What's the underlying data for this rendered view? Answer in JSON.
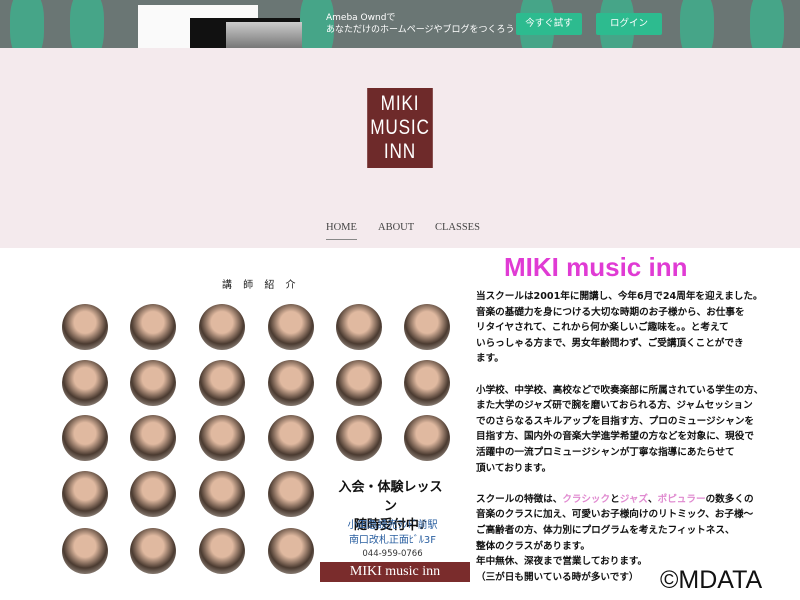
{
  "banner": {
    "line1": "Ameba Owndで",
    "line2": "あなただけのホームページやブログをつくろう",
    "try_button": "今すぐ試す",
    "login_button": "ログイン"
  },
  "logo": {
    "text": "MIKI MUSIC INN"
  },
  "nav": [
    {
      "label": "HOME"
    },
    {
      "label": "ABOUT"
    },
    {
      "label": "CLASSES"
    }
  ],
  "instructors": {
    "title": "講 師 紹 介"
  },
  "promo": {
    "line1": "入会・体験レッスン",
    "line2": "随時受付中♪",
    "addr1": "小田急読売ﾗﾝﾄﾞ前駅",
    "addr2": "南口改札正面ﾋﾞﾙ3F",
    "phone": "044-959-0766",
    "banner": "MIKI music inn"
  },
  "main": {
    "title": "MIKI music inn",
    "p1": [
      "当スクールは2001年に開講し、今年6月で24周年を迎えました。",
      "音楽の基礎力を身につける大切な時期のお子様から、お仕事を",
      "リタイヤされて、これから何か楽しいご趣味を。。と考えて",
      "いらっしゃる方まで、男女年齢問わず、ご受講頂くことができ",
      "ます。"
    ],
    "p2": [
      "小学校、中学校、高校などで吹奏楽部に所属されている学生の方、",
      "また大学のジャズ研で腕を磨いておられる方、ジャムセッション",
      "でのさらなるスキルアップを目指す方、プロのミュージシャンを",
      "目指す方、国内外の音楽大学進学希望の方などを対象に、現役で",
      "活躍中の一流プロミュージシャンが丁寧な指導にあたらせて",
      "頂いております。"
    ],
    "p3_a": "スクールの特徴は、",
    "p3_classic": "クラシック",
    "p3_to": "と",
    "p3_jazz": "ジャズ",
    "p3_comma": "、",
    "p3_pop": "ポピュラー",
    "p3_b": "の数多くの",
    "p3": [
      "音楽のクラスに加え、可愛いお子様向けのリトミック、お子様～",
      "ご高齢者の方、体力別にプログラムを考えたフィットネス、",
      "整体のクラスがあります。",
      "年中無休、深夜まで営業しております。",
      "（三が日も開いている時が多いです）"
    ]
  },
  "watermark": "©MDATA"
}
